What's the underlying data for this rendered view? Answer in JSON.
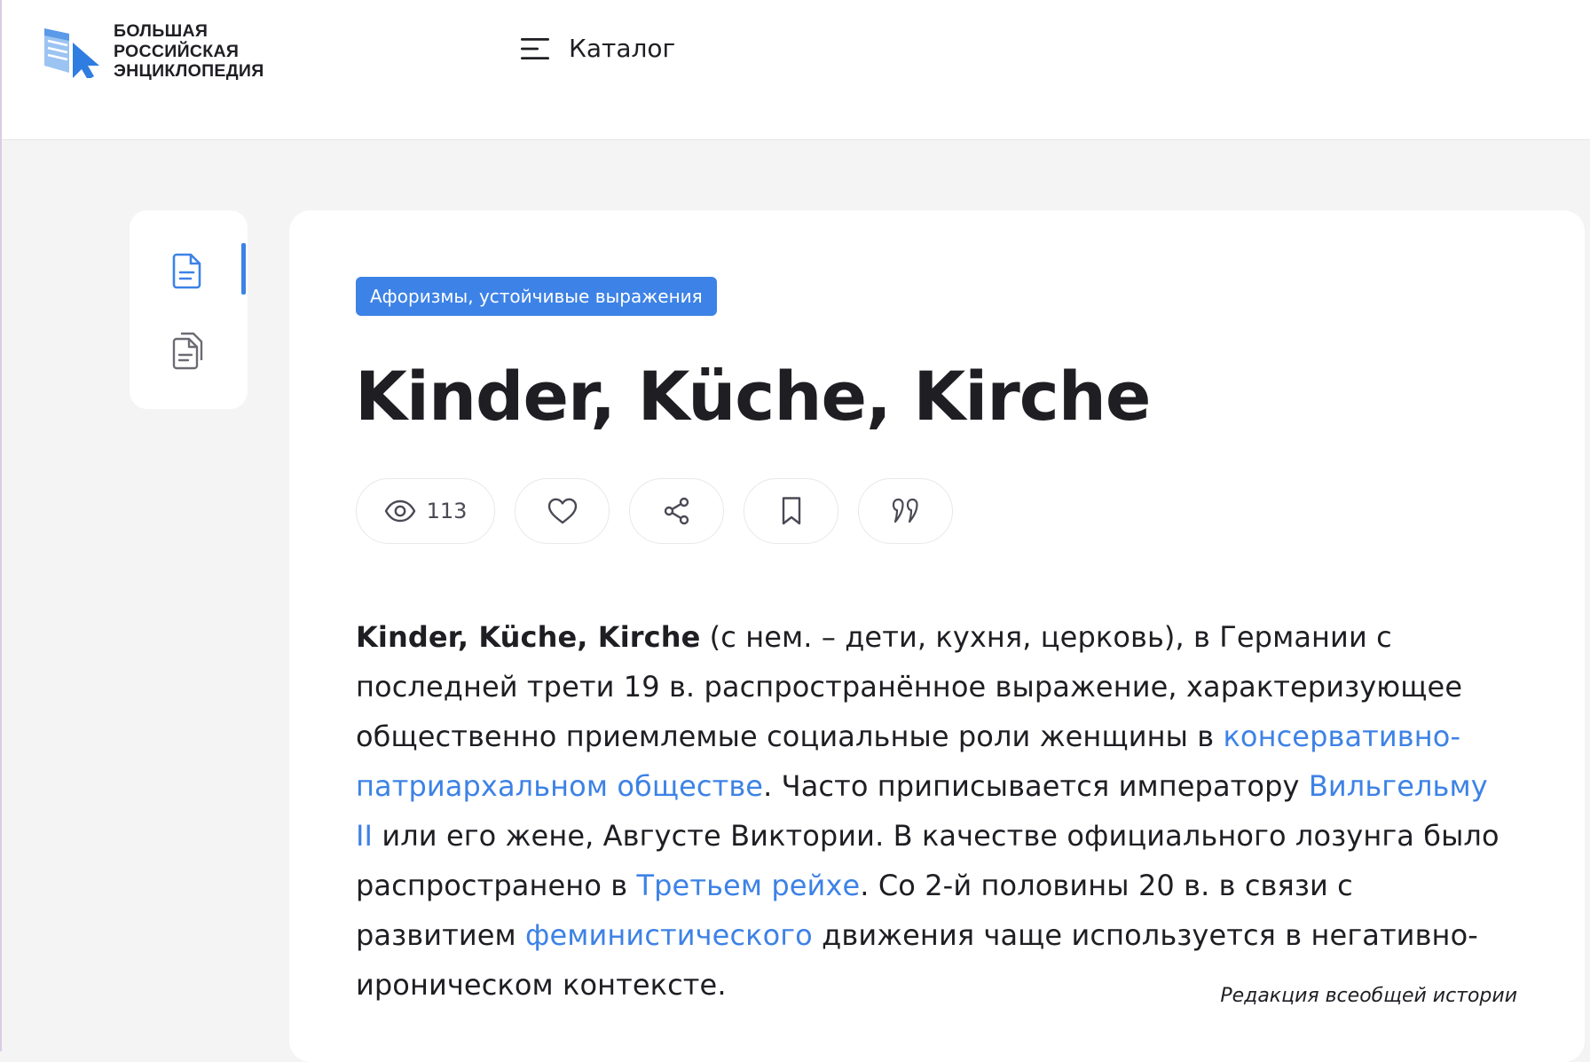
{
  "header": {
    "logo_lines": [
      "БОЛЬШАЯ",
      "РОССИЙСКАЯ",
      "ЭНЦИКЛОПЕДИЯ"
    ],
    "catalog_label": "Каталог"
  },
  "sidebar": {
    "items": [
      {
        "name": "article-tab",
        "icon": "document-icon",
        "active": true
      },
      {
        "name": "versions-tab",
        "icon": "documents-stack-icon",
        "active": false
      }
    ]
  },
  "article": {
    "tag": "Афоризмы, устойчивые выражения",
    "title": "Kinder, Küche, Kirche",
    "views": "113",
    "actions": [
      "eye-icon",
      "heart-icon",
      "share-icon",
      "bookmark-icon",
      "quote-icon"
    ],
    "body": {
      "term": "Kinder, Küche, Kirche",
      "t1": " (с нем. – дети, кухня, церковь), в Германии с последней трети 19 в. распространённое выражение, характеризующее общественно приемлемые социальные роли женщины в ",
      "link1": "консервативно-патриархальном обществе",
      "t2": ". Часто приписывается императору ",
      "link2": "Вильгельму II",
      "t3": " или его жене, Августе Виктории. В качестве официального лозунга было распространено в ",
      "link3": "Третьем рейхе",
      "t4": ". Со 2-й половины 20 в. в связи с развитием ",
      "link4": "феминистического",
      "t5": " движения чаще используется в негативно-ироническом контексте."
    },
    "author": "Редакция всеобщей истории"
  },
  "colors": {
    "accent": "#3d82e6",
    "text": "#1e1e23",
    "background": "#f4f4f4",
    "logo_light": "#8cbaf0"
  }
}
